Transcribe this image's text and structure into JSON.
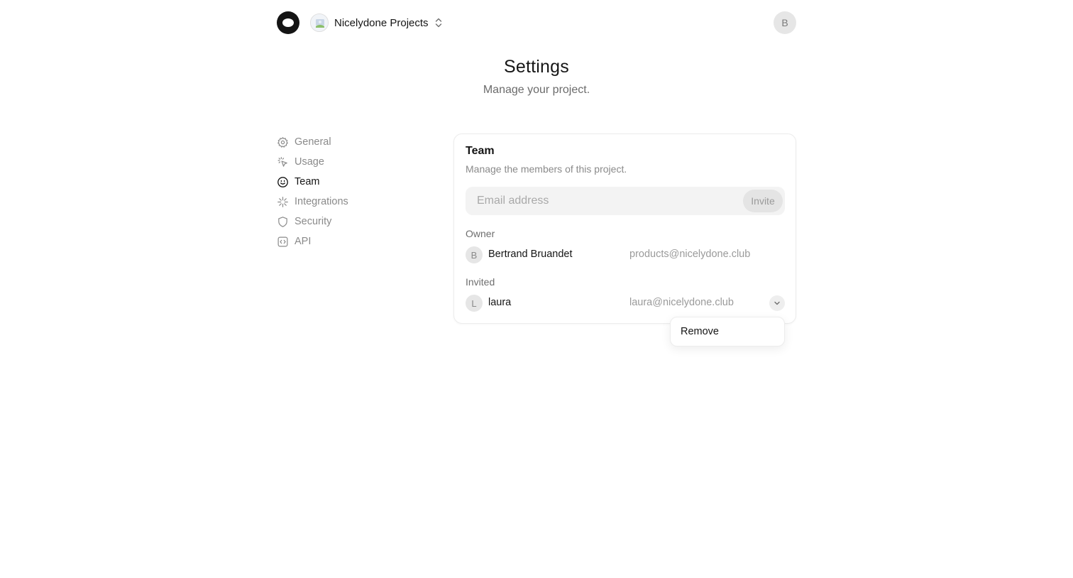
{
  "header": {
    "project_name": "Nicelydone Projects",
    "user_initial": "B"
  },
  "page": {
    "title": "Settings",
    "subtitle": "Manage your project."
  },
  "sidebar": {
    "items": [
      {
        "label": "General",
        "icon": "gear-icon",
        "active": false
      },
      {
        "label": "Usage",
        "icon": "cursor-click-icon",
        "active": false
      },
      {
        "label": "Team",
        "icon": "smiley-icon",
        "active": true
      },
      {
        "label": "Integrations",
        "icon": "sparkle-icon",
        "active": false
      },
      {
        "label": "Security",
        "icon": "shield-icon",
        "active": false
      },
      {
        "label": "API",
        "icon": "code-icon",
        "active": false
      }
    ]
  },
  "team": {
    "title": "Team",
    "description": "Manage the members of this project.",
    "email_placeholder": "Email address",
    "email_value": "",
    "invite_label": "Invite",
    "owner_label": "Owner",
    "owner": {
      "initial": "B",
      "name": "Bertrand Bruandet",
      "email": "products@nicelydone.club"
    },
    "invited_label": "Invited",
    "invited": [
      {
        "initial": "L",
        "name": "laura",
        "email": "laura@nicelydone.club"
      }
    ]
  },
  "dropdown": {
    "items": [
      {
        "label": "Remove"
      }
    ]
  },
  "colors": {
    "text_primary": "#141414",
    "text_muted": "#8a8a8a",
    "surface": "#f3f3f3",
    "border": "#ececec"
  }
}
